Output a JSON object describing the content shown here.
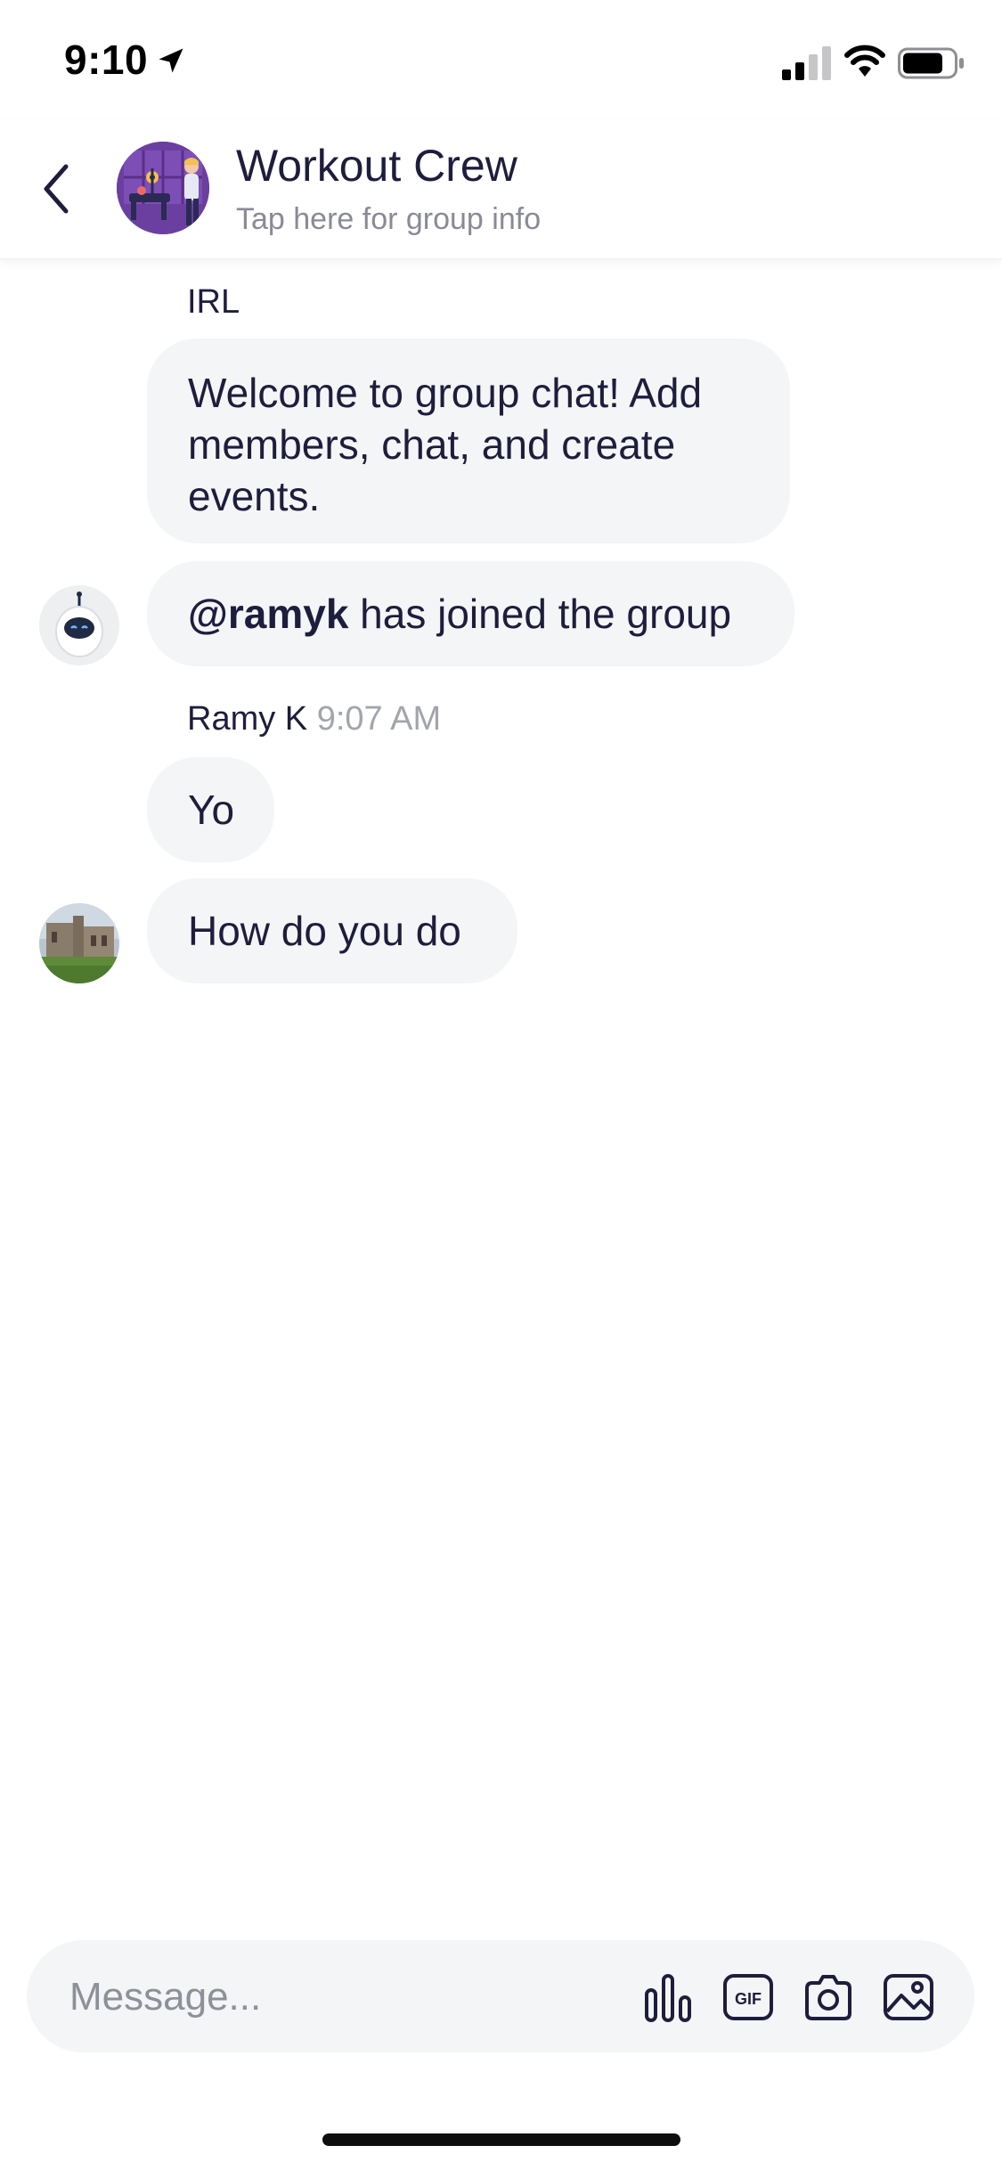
{
  "status_bar": {
    "time": "9:10"
  },
  "header": {
    "title": "Workout Crew",
    "subtitle": "Tap here for group info"
  },
  "messages": [
    {
      "sender": "IRL",
      "text": "Welcome to group chat! Add members, chat, and create events."
    },
    {
      "mention": "@ramyk",
      "text": " has joined the group"
    },
    {
      "sender": "Ramy K",
      "time": "9:07 AM",
      "text": "Yo"
    },
    {
      "text": "How do you do"
    }
  ],
  "composer": {
    "placeholder": "Message...",
    "tools": [
      "poll-icon",
      "gif-icon",
      "camera-icon",
      "photo-icon"
    ],
    "gif_label": "GIF"
  },
  "colors": {
    "text": "#1f1d3d",
    "bubble": "#f4f5f6",
    "muted": "#8a8a96"
  }
}
